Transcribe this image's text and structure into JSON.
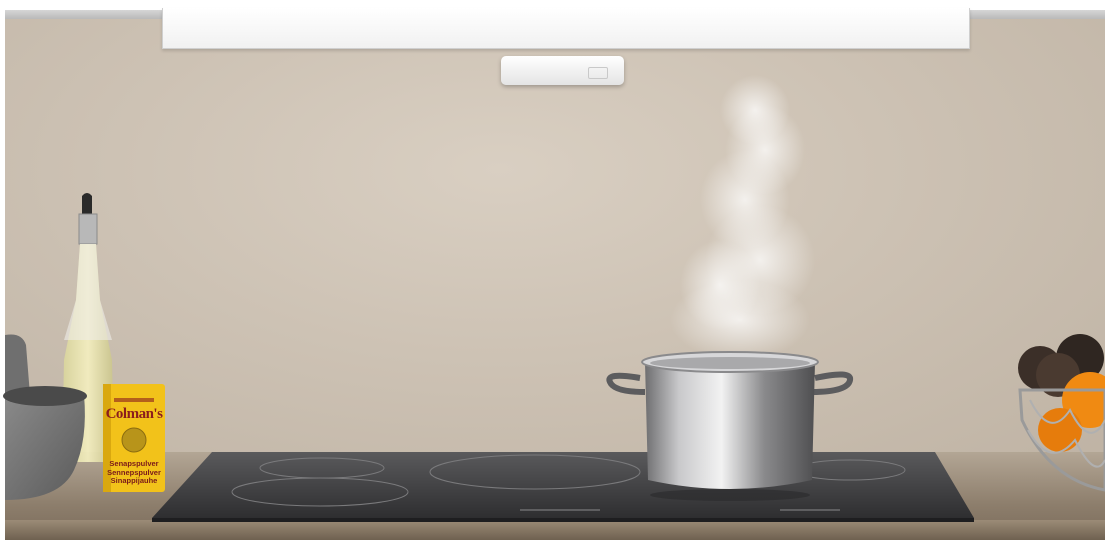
{
  "scene": {
    "description_elements": [
      "range-hood",
      "hood-sensor",
      "oil-bottle",
      "mortar",
      "mustard-tin",
      "induction-hob",
      "steel-pot",
      "steam",
      "fruit-bowl",
      "countertop"
    ]
  },
  "mustard_tin": {
    "brand": "Colman's",
    "lines": [
      "Senapspulver",
      "Sennepspulver",
      "Sinappijauhe"
    ]
  },
  "colors": {
    "wall": "#cdc2b4",
    "hood": "#ffffff",
    "counter": "#8d7e6c",
    "hob_glass": "#3c3c3e",
    "tin_yellow": "#f2c21a",
    "tin_red": "#8b1d1d",
    "orange": "#f08a12"
  }
}
